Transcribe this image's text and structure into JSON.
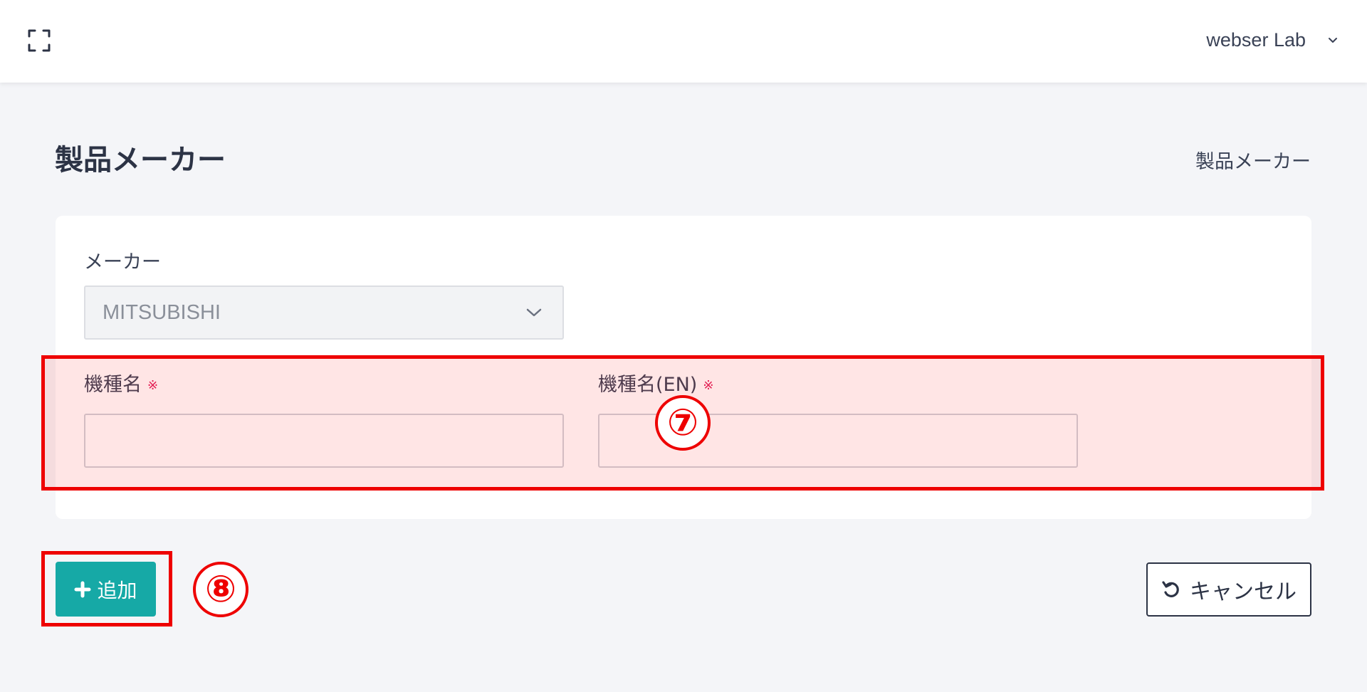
{
  "header": {
    "user_name": "webser Lab",
    "fullscreen_icon": "fullscreen-icon",
    "user_menu_icon": "chevron-down-icon"
  },
  "page": {
    "title": "製品メーカー",
    "breadcrumb": "製品メーカー"
  },
  "form": {
    "maker_label": "メーカー",
    "maker_value": "MITSUBISHI",
    "model_label": "機種名",
    "model_en_label": "機種名(EN)",
    "required_mark": "※",
    "model_value": "",
    "model_en_value": ""
  },
  "annotations": {
    "marker7": "⑦",
    "marker8": "⑧",
    "highlight_color": "#ee0000"
  },
  "actions": {
    "add_label": "追加",
    "cancel_label": "キャンセル"
  },
  "colors": {
    "accent": "#16a9a6",
    "text": "#2c3345",
    "background": "#f4f5f8"
  }
}
